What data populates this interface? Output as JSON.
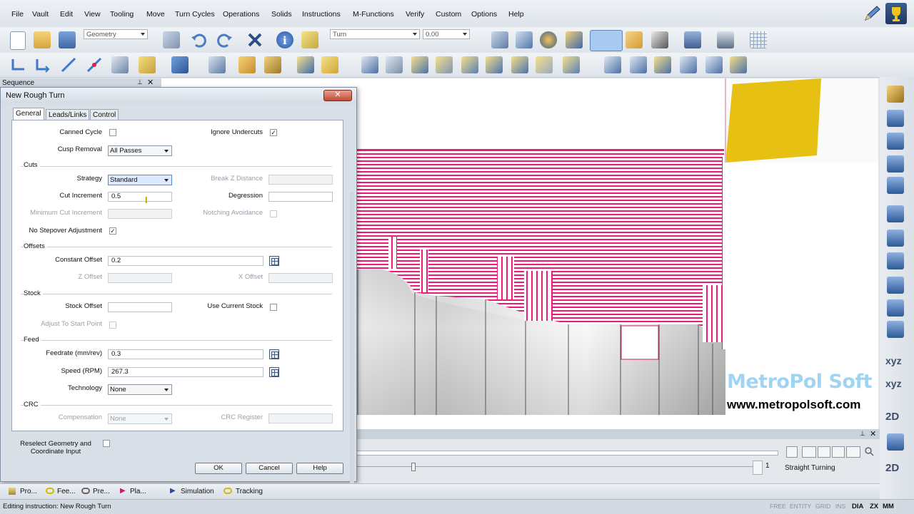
{
  "menu": [
    "File",
    "Vault",
    "Edit",
    "View",
    "Tooling",
    "Move",
    "Turn Cycles",
    "Operations",
    "Solids",
    "Instructions",
    "M-Functions",
    "Verify",
    "Custom",
    "Options",
    "Help"
  ],
  "toolbar": {
    "geometry_combo": "Geometry",
    "turn_combo": "Turn",
    "value_combo": "0.00"
  },
  "sequence": {
    "title": "Sequence"
  },
  "dialog": {
    "title": "New Rough Turn",
    "tabs": [
      "General",
      "Leads/Links",
      "Control"
    ],
    "canned_cycle": {
      "label": "Canned Cycle",
      "checked": false
    },
    "ignore_undercuts": {
      "label": "Ignore Undercuts",
      "checked": true
    },
    "cusp_removal": {
      "label": "Cusp Removal",
      "value": "All Passes"
    },
    "cuts": {
      "section": "Cuts",
      "strategy_label": "Strategy",
      "strategy_value": "Standard",
      "break_z_label": "Break Z Distance",
      "cut_increment_label": "Cut Increment",
      "cut_increment_value": "0.5",
      "degression_label": "Degression",
      "min_cut_label": "Minimum Cut Increment",
      "notching_label": "Notching Avoidance",
      "no_stepover_label": "No Stepover Adjustment",
      "no_stepover_checked": true
    },
    "offsets": {
      "section": "Offsets",
      "constant_label": "Constant Offset",
      "constant_value": "0.2",
      "z_label": "Z Offset",
      "x_label": "X Offset"
    },
    "stock": {
      "section": "Stock",
      "stock_offset_label": "Stock Offset",
      "use_current_label": "Use Current Stock",
      "adjust_label": "Adjust To Start Point"
    },
    "feed": {
      "section": "Feed",
      "feedrate_label": "Feedrate (mm/rev)",
      "feedrate_value": "0.3",
      "speed_label": "Speed (RPM)",
      "speed_value": "267.3",
      "technology_label": "Technology",
      "technology_value": "None"
    },
    "crc": {
      "section": "CRC",
      "compensation_label": "Compensation",
      "compensation_value": "None",
      "register_label": "CRC Register"
    },
    "reselect_label_line1": "Reselect Geometry and",
    "reselect_label_line2": "Coordinate Input",
    "buttons": {
      "ok": "OK",
      "cancel": "Cancel",
      "help": "Help"
    }
  },
  "viewport": {
    "toolpath_color": "#ee1a7a",
    "tool_color": "#e6c012",
    "watermark_logo": "MetroPol Soft",
    "watermark_url": "www.metropolsoft.com"
  },
  "right_toolbar": {
    "xyz1": "xyz",
    "xyz2": "xyz",
    "view2d_1": "2D",
    "view2d_2": "2D"
  },
  "animation": {
    "counter": "1",
    "operation": "Straight Turning"
  },
  "bottom_tabs": [
    "Pro...",
    "Fee...",
    "Pre...",
    "Pla...",
    "Simulation",
    "Tracking"
  ],
  "status": {
    "text": "Editing instruction:  New Rough Turn",
    "indicators": [
      "FREE",
      "ENTITY",
      "GRID",
      "INS",
      "DIA",
      "ZX",
      "MM"
    ]
  }
}
